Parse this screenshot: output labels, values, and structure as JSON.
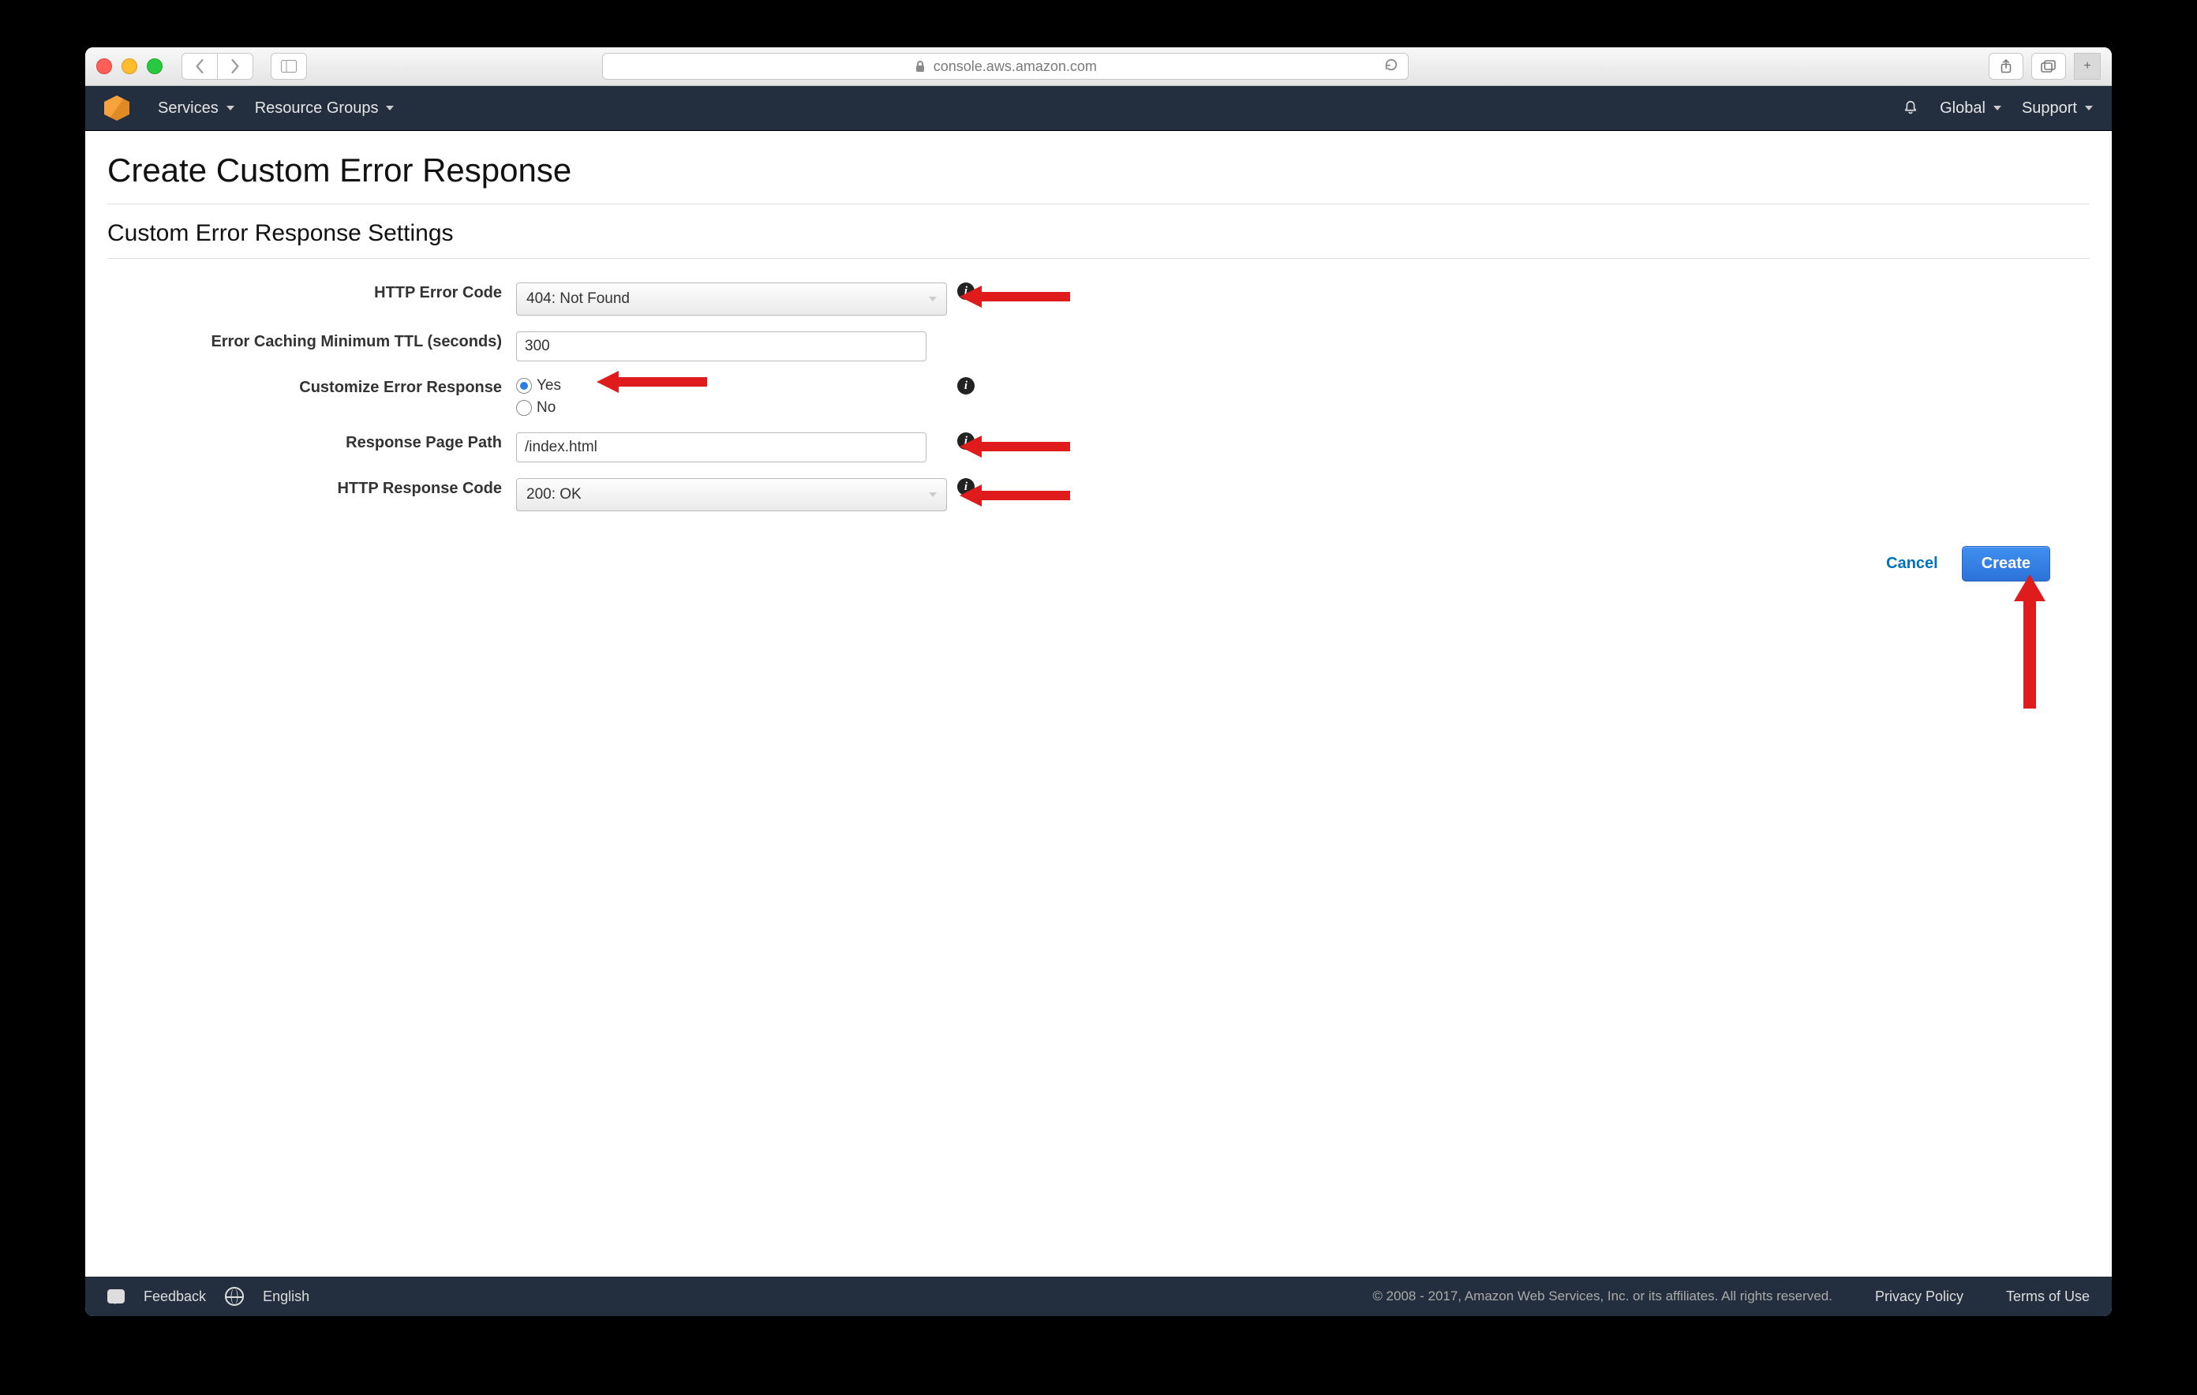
{
  "browser": {
    "url_host": "console.aws.amazon.com"
  },
  "awsnav": {
    "services": "Services",
    "resource_groups": "Resource Groups",
    "region": "Global",
    "support": "Support"
  },
  "page": {
    "title": "Create Custom Error Response",
    "subtitle": "Custom Error Response Settings"
  },
  "form": {
    "http_error_code": {
      "label": "HTTP Error Code",
      "value": "404: Not Found"
    },
    "ttl": {
      "label": "Error Caching Minimum TTL (seconds)",
      "value": "300"
    },
    "customize": {
      "label": "Customize Error Response",
      "yes": "Yes",
      "no": "No",
      "selected": "yes"
    },
    "response_path": {
      "label": "Response Page Path",
      "value": "/index.html"
    },
    "http_response_code": {
      "label": "HTTP Response Code",
      "value": "200: OK"
    }
  },
  "buttons": {
    "cancel": "Cancel",
    "create": "Create"
  },
  "footer": {
    "feedback": "Feedback",
    "language": "English",
    "copyright": "© 2008 - 2017, Amazon Web Services, Inc. or its affiliates. All rights reserved.",
    "privacy": "Privacy Policy",
    "terms": "Terms of Use"
  }
}
